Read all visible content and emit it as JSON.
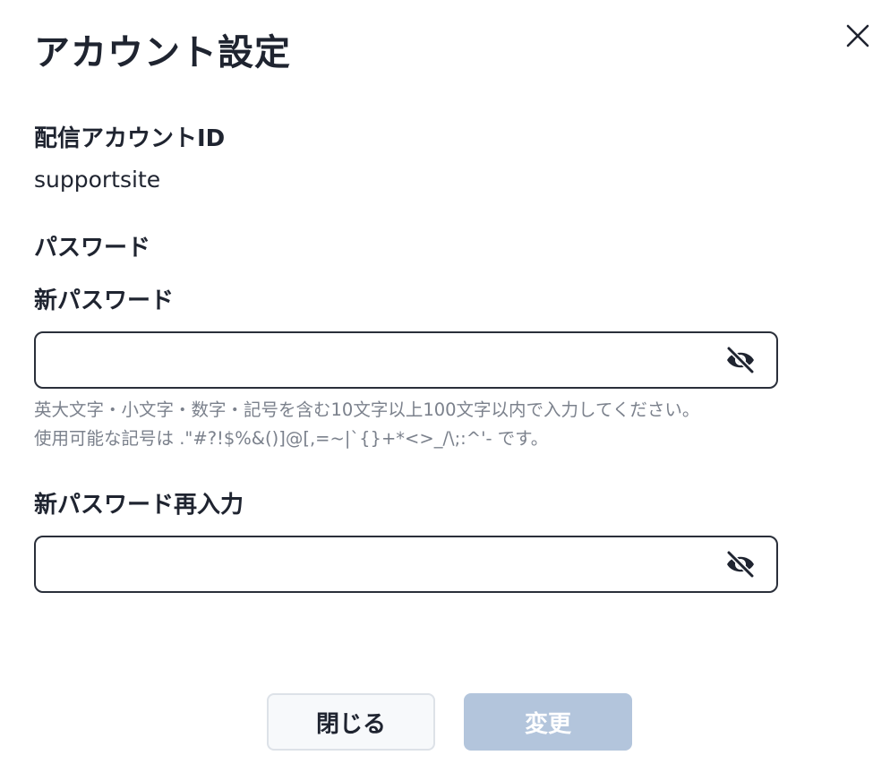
{
  "dialog": {
    "title": "アカウント設定",
    "close_icon": "close-icon"
  },
  "account_id": {
    "label": "配信アカウントID",
    "value": "supportsite"
  },
  "password_section": {
    "label": "パスワード"
  },
  "new_password": {
    "label": "新パスワード",
    "value": "",
    "placeholder": "",
    "toggle_icon": "eye-off-icon",
    "hint_line1": "英大文字・小文字・数字・記号を含む10文字以上100文字以内で入力してください。",
    "hint_line2": "使用可能な記号は .\"#?!$%&()]@[,=~|`{}+*<>_/\\;:^'- です。"
  },
  "confirm_password": {
    "label": "新パスワード再入力",
    "value": "",
    "placeholder": "",
    "toggle_icon": "eye-off-icon"
  },
  "footer": {
    "close_label": "閉じる",
    "submit_label": "変更"
  },
  "colors": {
    "text": "#1f2430",
    "hint": "#7b818c",
    "border": "#2a2f3a",
    "submit_disabled": "#b3c5dc",
    "close_bg": "#f7f9fb",
    "close_border": "#dde2e8"
  }
}
